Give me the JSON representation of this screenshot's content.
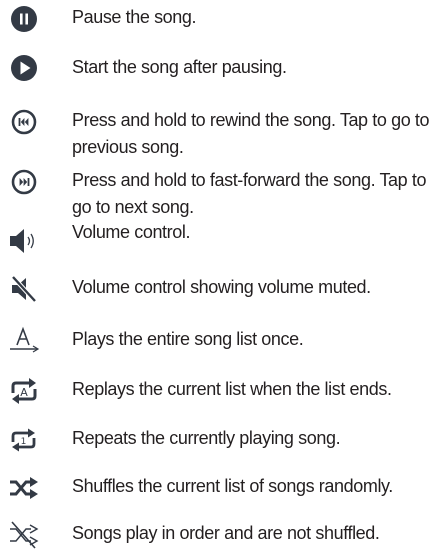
{
  "legend": {
    "items": [
      {
        "icon": "pause-icon",
        "text": "Pause the song."
      },
      {
        "icon": "play-icon",
        "text": "Start the song after pausing."
      },
      {
        "icon": "rewind-icon",
        "text": "Press and hold to rewind the song. Tap to go to previous song."
      },
      {
        "icon": "fast-forward-icon",
        "text": "Press and hold to fast-forward  the song. Tap to go to next song."
      },
      {
        "icon": "volume-icon",
        "text": "Volume control."
      },
      {
        "icon": "volume-muted-icon",
        "text": "Volume control showing volume muted."
      },
      {
        "icon": "play-list-once-icon",
        "text": "Plays the entire song list once."
      },
      {
        "icon": "repeat-all-icon",
        "text": "Replays the current list when the list ends."
      },
      {
        "icon": "repeat-one-icon",
        "text": "Repeats the currently playing song."
      },
      {
        "icon": "shuffle-on-icon",
        "text": "Shuffles the current list of songs randomly."
      },
      {
        "icon": "shuffle-off-icon",
        "text": "Songs play in order and are not shuffled."
      }
    ]
  },
  "colors": {
    "icon_dark": "#333a45",
    "text": "#231f20"
  }
}
